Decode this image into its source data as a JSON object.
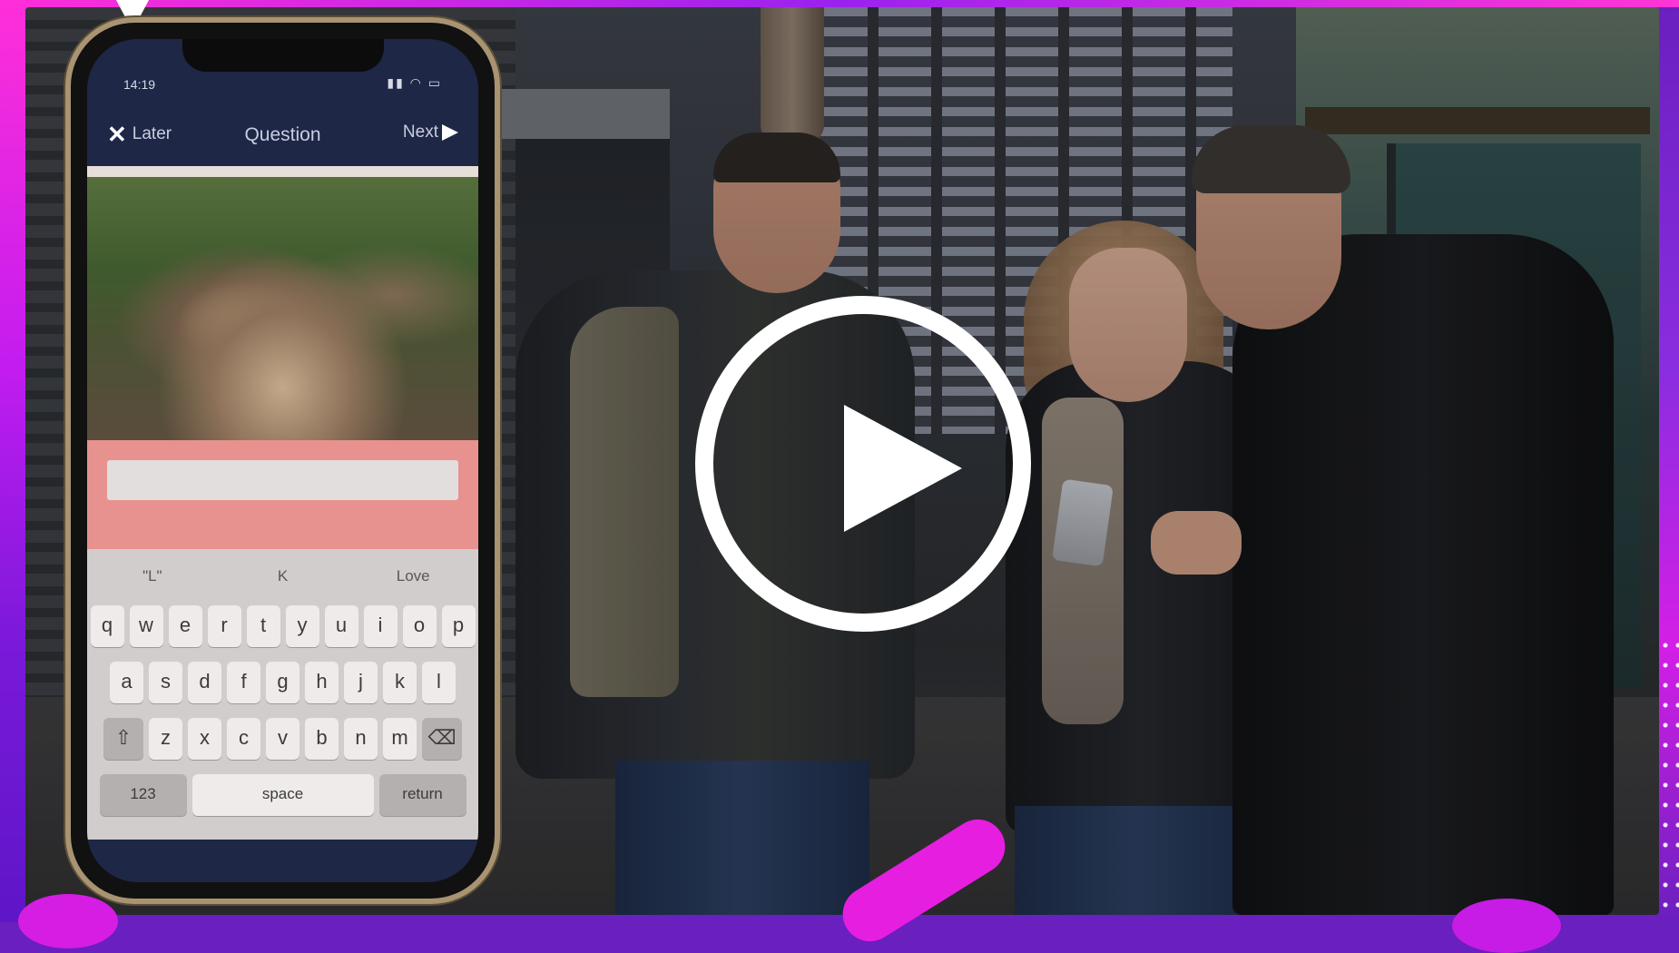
{
  "video": {
    "play_label": "Play video",
    "accent_colors": [
      "#ff2fd8",
      "#7a19d9",
      "#e61ee0"
    ]
  },
  "phone": {
    "status_time": "14:19",
    "status_icons": "▮▮ ◠ ▭",
    "nav": {
      "later_label": "Later",
      "title": "Question",
      "next_label": "Next"
    },
    "answer_placeholder": "",
    "keyboard": {
      "suggestions": [
        "\"L\"",
        "K",
        "Love"
      ],
      "row1": [
        "q",
        "w",
        "e",
        "r",
        "t",
        "y",
        "u",
        "i",
        "o",
        "p"
      ],
      "row2": [
        "a",
        "s",
        "d",
        "f",
        "g",
        "h",
        "j",
        "k",
        "l"
      ],
      "row3": [
        "z",
        "x",
        "c",
        "v",
        "b",
        "n",
        "m"
      ],
      "shift_icon": "⇧",
      "delete_icon": "⌫",
      "numbers_label": "123",
      "space_label": "space",
      "return_label": "return"
    }
  }
}
